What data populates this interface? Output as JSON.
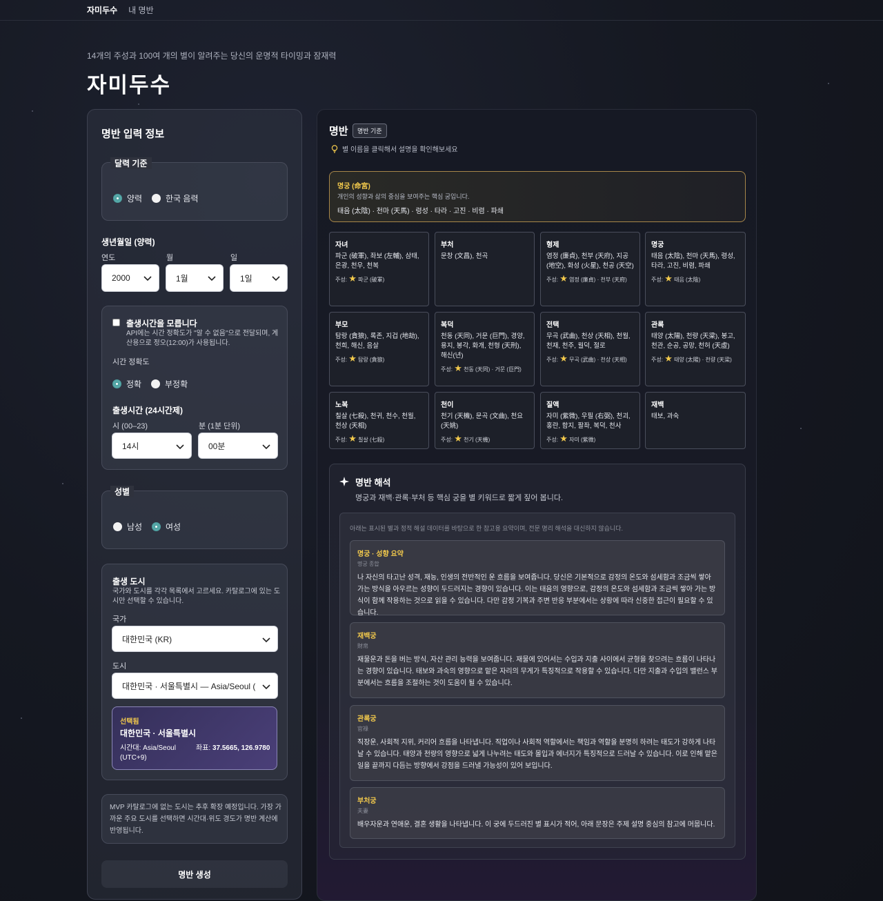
{
  "nav": {
    "active": "자미두수",
    "other": "내 명반"
  },
  "hero": {
    "subtitle": "14개의 주성과 100여 개의 별이 알려주는 당신의 운명적 타이밍과 잠재력",
    "title": "자미두수"
  },
  "form": {
    "title": "명반 입력 정보",
    "calendar": {
      "legend": "달력 기준",
      "options": [
        "양력",
        "한국 음력"
      ],
      "selected": "양력"
    },
    "birthdate": {
      "label": "생년월일 (양력)",
      "year_label": "연도",
      "month_label": "월",
      "day_label": "일",
      "year": "2000",
      "month": "1월",
      "day": "1일"
    },
    "unknown_time": {
      "label": "출생시간을 모릅니다",
      "note": "API에는 시간 정확도가 \"알 수 없음\"으로 전달되며, 계산용으로 정오(12:00)가 사용됩니다.",
      "accuracy_label": "시간 정확도",
      "accuracy_options": [
        "정확",
        "부정확"
      ],
      "accuracy_selected": "정확"
    },
    "birth_time": {
      "label": "출생시간 (24시간제)",
      "hour_label": "시 (00–23)",
      "minute_label": "분 (1분 단위)",
      "hour": "14시",
      "minute": "00분"
    },
    "gender": {
      "legend": "성별",
      "options": [
        "남성",
        "여성"
      ],
      "selected": "여성"
    },
    "city": {
      "label": "출생 도시",
      "note": "국가와 도시를 각각 목록에서 고르세요. 카탈로그에 있는 도시만 선택할 수 있습니다.",
      "country_label": "국가",
      "country": "대한민국 (KR)",
      "city_label": "도시",
      "city": "대한민국 · 서울특별시 — Asia/Seoul (",
      "selected": {
        "tag": "선택됨",
        "name": "대한민국 · 서울특별시",
        "tz": "시간대: Asia/Seoul (UTC+9)",
        "coord_label": "좌표:",
        "coords": "37.5665, 126.9780"
      }
    },
    "mvp_note": "MVP 카탈로그에 없는 도시는 추후 확장 예정입니다. 가장 가까운 주요 도시를 선택하면 시간대·위도 경도가 명반 계산에 반영됩니다.",
    "submit": "명반 생성"
  },
  "chart": {
    "title": "명반",
    "badge": "명반 기준",
    "hint": "별 이름을 클릭해서 설명을 확인해보세요",
    "main": {
      "name": "명궁 (命宮)",
      "desc": "개인의 성향과 삶의 중심을 보여주는 핵심 궁입니다.",
      "stars": "태음 (太陰) · 천마 (天馬) · 령성 · 타라 · 고진 · 비렴 · 파쇄"
    },
    "palaces": [
      {
        "name": "자녀",
        "stars": "파군 (破軍), 좌보 (左輔), 삼태, 은광, 천우, 천복",
        "major": "파군 (破軍)"
      },
      {
        "name": "부처",
        "stars": "문창 (文昌), 천곡",
        "major": ""
      },
      {
        "name": "형제",
        "stars": "염정 (廉貞), 천부 (天府), 지공 (地空), 화성 (火星), 천공 (天空)",
        "major": "염정 (廉貞) · 천부 (天府)"
      },
      {
        "name": "명궁",
        "stars": "태음 (太陰), 천마 (天馬), 령성, 타라, 고진, 비렴, 파쇄",
        "major": "태음 (太陰)"
      },
      {
        "name": "부모",
        "stars": "탐랑 (貪狼), 록존, 지겁 (地劫), 천희, 해신, 음살",
        "major": "탐랑 (貪狼)"
      },
      {
        "name": "복덕",
        "stars": "천동 (天同), 거문 (巨門), 경양, 용지, 봉각, 화개, 천형 (天刑), 해신(년)",
        "major": "천동 (天同) · 거문 (巨門)"
      },
      {
        "name": "전택",
        "stars": "무곡 (武曲), 천상 (天相), 천월, 천재, 천주, 월덕, 절로",
        "major": "무곡 (武曲) · 천상 (天相)"
      },
      {
        "name": "관록",
        "stars": "태양 (太陽), 천량 (天梁), 봉고, 천관, 순공, 공망, 천허 (天虛)",
        "major": "태양 (太陽) · 천량 (天梁)"
      },
      {
        "name": "노복",
        "stars": "칠살 (七殺), 천귀, 천수, 천월, 천상 (天相)",
        "major": "칠살 (七殺)"
      },
      {
        "name": "천이",
        "stars": "천기 (天機), 문곡 (文曲), 천요 (天姚)",
        "major": "천기 (天機)"
      },
      {
        "name": "질액",
        "stars": "자미 (紫微), 우필 (右弼), 천괴, 홍란, 함지, 팔좌, 복덕, 천사",
        "major": "자미 (紫微)"
      },
      {
        "name": "재백",
        "stars": "태보, 과숙",
        "major": ""
      }
    ],
    "major_label": "주성:",
    "interp": {
      "title": "명반 해석",
      "subtitle": "명궁과 재백·관록·부처 등 핵심 궁을 별 키워드로 짧게 짚어 봅니다.",
      "disclaimer": "아래는 표시된 별과 정적 해설 데이터를 바탕으로 한 참고용 요약이며, 전문 명리 해석을 대신하지 않습니다.",
      "cards": [
        {
          "title": "명궁 · 성향 요약",
          "sub": "명궁 종합",
          "body": "나 자신의 타고난 성격, 재능, 인생의 전반적인 운 흐름을 보여줍니다. 당신은 기본적으로 감정의 온도와 섬세함과 조금씩 쌓아 가는 방식을 아우르는 성향이 두드러지는 경향이 있습니다. 이는 태음의 영향으로, 감정의 온도와 섬세함과 조금씩 쌓아 가는 방식이 함께 작용하는 것으로 읽을 수 있습니다. 다만 감정 기복과 주변 반응 부분에서는 상황에 따라 신중한 접근이 필요할 수 있습니다."
        },
        {
          "title": "재백궁",
          "sub": "財帛",
          "body": "재물운과 돈을 버는 방식, 자산 관리 능력을 보여줍니다. 재물에 있어서는 수입과 지출 사이에서 균형을 찾으려는 흐름이 나타나는 경향이 있습니다. 태보와 과숙의 영향으로 맡은 자리의 무게가 특징적으로 작용할 수 있습니다. 다만 지출과 수입의 밸런스 부분에서는 흐름을 조절하는 것이 도움이 될 수 있습니다."
        },
        {
          "title": "관록궁",
          "sub": "官祿",
          "body": "직장운, 사회적 지위, 커리어 흐름을 나타냅니다. 직업이나 사회적 역할에서는 책임과 역할을 분명히 하려는 태도가 강하게 나타날 수 있습니다. 태양과 천량의 영향으로 넓게 나누려는 태도와 몰입과 에너지가 특징적으로 드러날 수 있습니다. 이로 인해 맡은 일을 끝까지 다듬는 방향에서 강점을 드러낼 가능성이 있어 보입니다."
        },
        {
          "title": "부처궁",
          "sub": "夫妻",
          "body": "배우자운과 연애운, 결혼 생활을 나타냅니다. 이 궁에 두드러진 별 표시가 적어, 아래 문장은 주제 설명 중심의 참고에 머뭅니다."
        }
      ]
    }
  }
}
